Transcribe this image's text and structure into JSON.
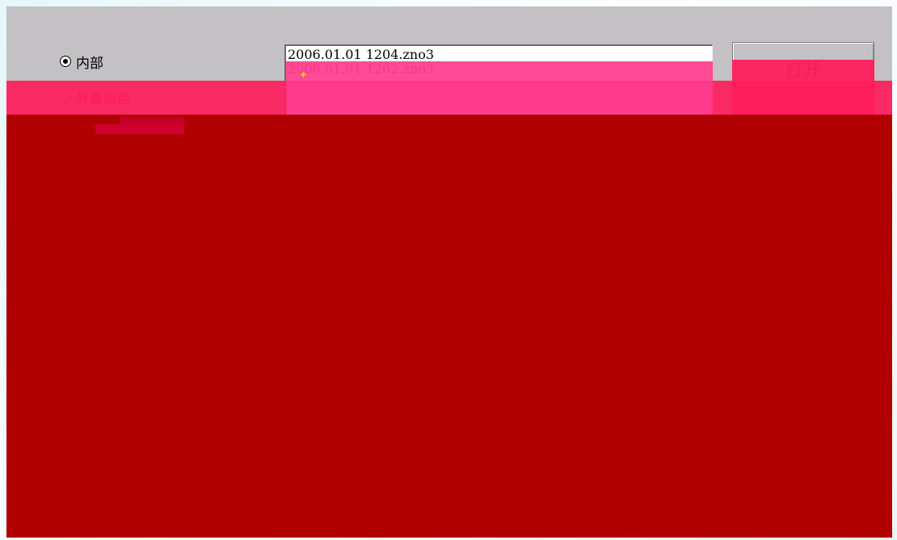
{
  "storage_options": {
    "internal_label": "内部",
    "external_label": "外置磁盘",
    "selected": "internal"
  },
  "file_list": {
    "items": [
      "2006.01.01 1204.zno3",
      "2006.01.01 1202.zno3"
    ]
  },
  "buttons": {
    "open_label": "打开",
    "second_label": ""
  },
  "colors": {
    "dialog_background": "#c3c1c3",
    "overlay_pink": "#ff1d5c",
    "overlay_red": "#b10000"
  }
}
